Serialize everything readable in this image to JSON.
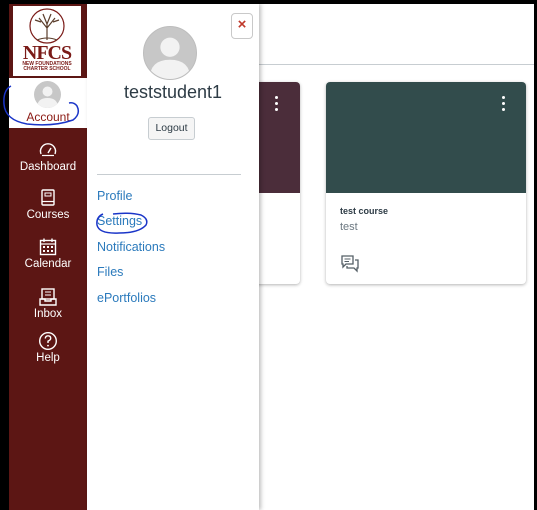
{
  "nav": {
    "logo_text": "NFCS",
    "logo_sub": "NEW FOUNDATIONS CHARTER SCHOOL",
    "account_label": "Account",
    "items": [
      {
        "label": "Dashboard",
        "icon": "dashboard-gauge-icon"
      },
      {
        "label": "Courses",
        "icon": "courses-book-icon"
      },
      {
        "label": "Calendar",
        "icon": "calendar-icon"
      },
      {
        "label": "Inbox",
        "icon": "inbox-icon"
      },
      {
        "label": "Help",
        "icon": "help-question-icon"
      }
    ],
    "background_color": "#5c1614"
  },
  "tray": {
    "close_symbol": "×",
    "username": "teststudent1",
    "logout_label": "Logout",
    "links": [
      {
        "label": "Profile"
      },
      {
        "label": "Settings"
      },
      {
        "label": "Notifications"
      },
      {
        "label": "Files"
      },
      {
        "label": "ePortfolios"
      }
    ],
    "link_color": "#2b7abc"
  },
  "cards": [
    {
      "title": "",
      "subtitle": "",
      "color": "#4b2d3a",
      "icon": "discussion-icon"
    },
    {
      "title": "test course",
      "subtitle": "test",
      "color": "#324c4c",
      "icon": "discussion-icon"
    }
  ],
  "annotations": {
    "circle_color": "#1a35c8"
  }
}
